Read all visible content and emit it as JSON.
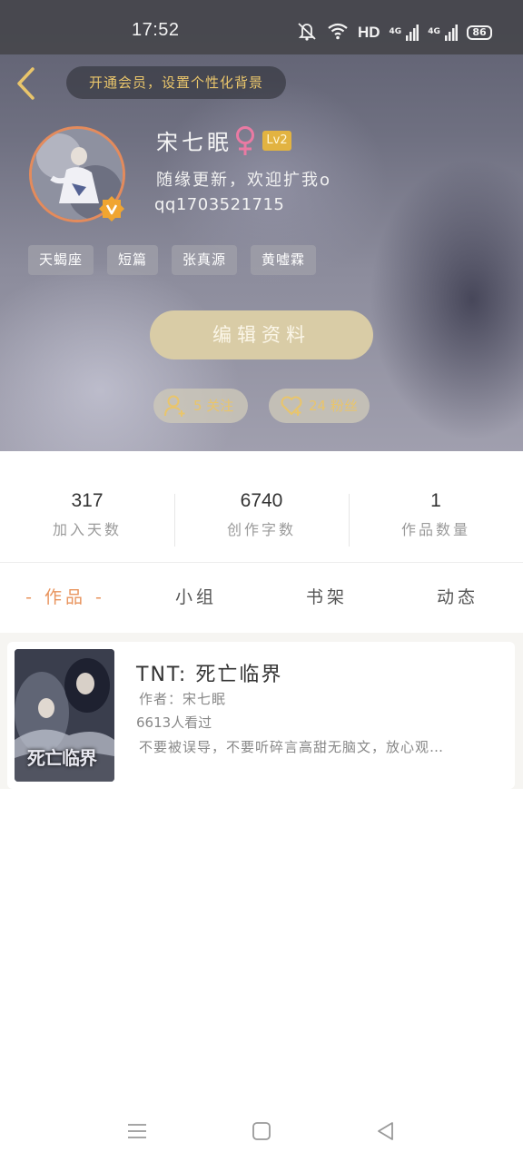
{
  "status_bar": {
    "time": "17:52",
    "hd": "HD",
    "net1": "4G",
    "net2": "4G",
    "battery": "86",
    "icons": [
      "mute-icon",
      "wifi-icon",
      "signal-icon",
      "signal-icon",
      "battery-icon"
    ]
  },
  "header": {
    "vip_prompt": "开通会员，设置个性化背景",
    "accent_color": "#e9c56b"
  },
  "profile": {
    "username": "宋七眠",
    "gender": "female",
    "level": "Lv2",
    "bio": "随缘更新，欢迎扩我o",
    "qq": "qq1703521715",
    "tags": [
      "天蝎座",
      "短篇",
      "张真源",
      "黄嘘霖"
    ],
    "edit_button": "编辑资料",
    "following": "5 关注",
    "fans": "24 粉丝"
  },
  "stats": [
    {
      "value": "317",
      "label": "加入天数"
    },
    {
      "value": "6740",
      "label": "创作字数"
    },
    {
      "value": "1",
      "label": "作品数量"
    }
  ],
  "tabs": [
    {
      "label": "- 作品 -",
      "active": true
    },
    {
      "label": "小组",
      "active": false
    },
    {
      "label": "书架",
      "active": false
    },
    {
      "label": "动态",
      "active": false
    }
  ],
  "works": [
    {
      "title": "TNT: 死亡临界",
      "author": "作者：宋七眠",
      "views": "6613人看过",
      "description": "不要被误导，不要听碎言高甜无脑文，放心观…",
      "cover_text": "死亡临界"
    }
  ],
  "colors": {
    "tab_active": "#e8935c",
    "edit_button_bg": "#d9cca6",
    "level_badge": "#e2b341"
  }
}
